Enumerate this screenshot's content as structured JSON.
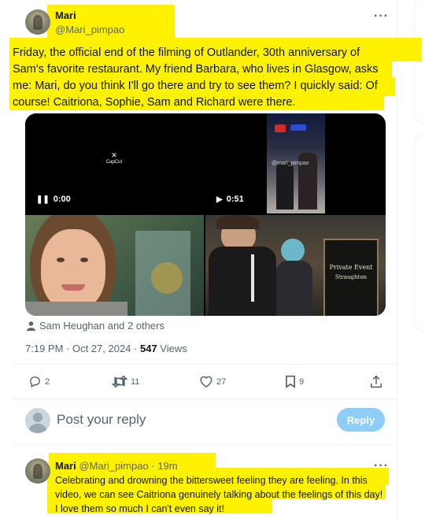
{
  "post": {
    "name": "Mari",
    "handle": "@Mari_pimpao",
    "more": "···",
    "text_lines": [
      "Friday, the official end of the filming of Outlander, 30th anniversary of",
      "Sam's favorite restaurant. My friend Barbara, who lives in Glasgow, asks",
      "me: Mari, do you think I'll go there and try to see them? I quickly said: Of",
      "course! Caitriona, Sophie, Sam and Richard were there."
    ],
    "media": {
      "video1_time": "0:00",
      "video1_watermark": "CapCut",
      "video2_time": "0:51",
      "video2_watermark": "@mari_pimpao",
      "sign_text": [
        "Private Event",
        "Straughton"
      ]
    },
    "tagged": "Sam Heughan and 2 others",
    "time": "7:19 PM · Oct 27, 2024 · ",
    "views_count": "547",
    "views_label": " Views",
    "stats": {
      "replies": "2",
      "reposts": "11",
      "likes": "27",
      "bookmarks": "9"
    }
  },
  "composer": {
    "placeholder": "Post your reply",
    "button": "Reply"
  },
  "reply": {
    "name": "Mari",
    "handle": "@Mari_pimpao · 19m",
    "more": "···",
    "text_lines": [
      "Celebrating and drowning the bittersweet feeling they are feeling. In this",
      "video, we can see Caitriona genuinely talking about the feelings of this day!",
      "I love them so much I can't even say it!"
    ]
  },
  "colors": {
    "highlight": "#fff200",
    "accent": "#1d9bf0",
    "reply_button": "#8ecdf8"
  }
}
